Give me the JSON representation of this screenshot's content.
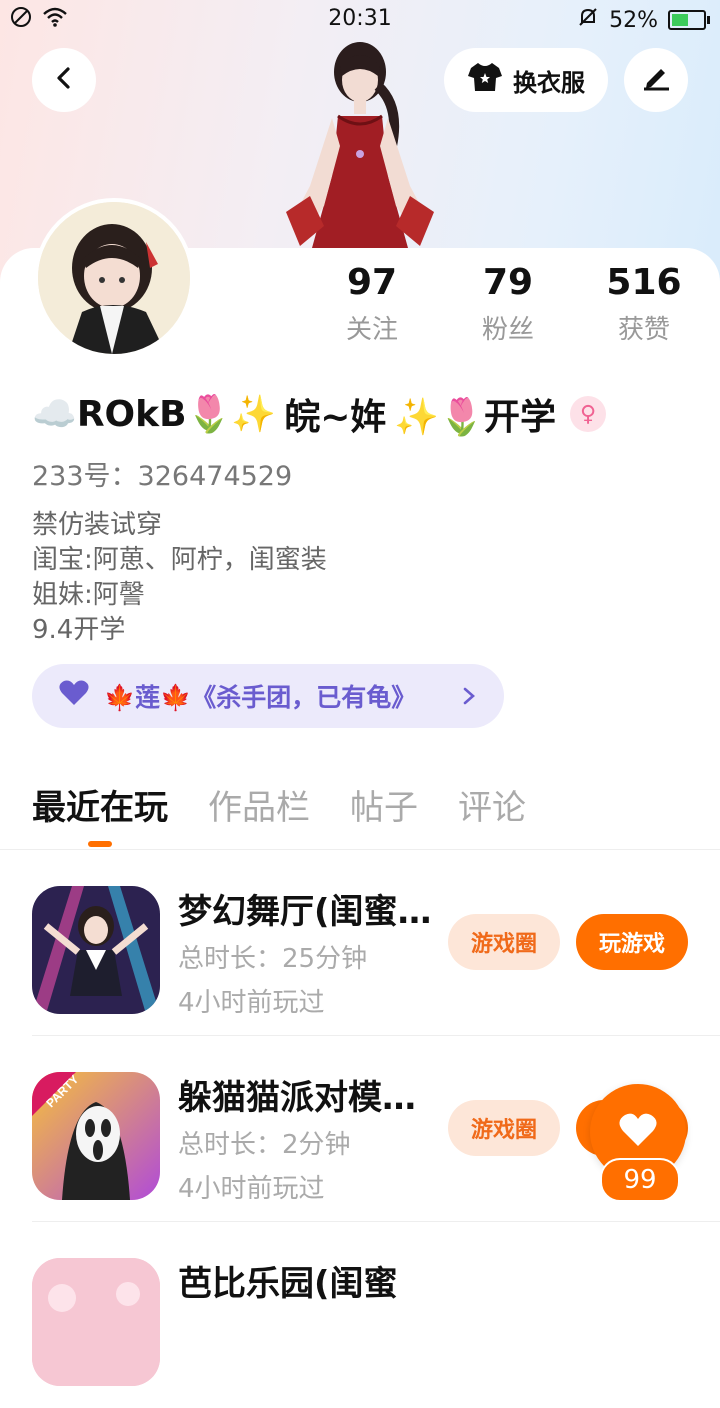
{
  "status_bar": {
    "time": "20:31",
    "battery": "52%"
  },
  "header": {
    "back_icon": "chevron-left-icon",
    "outfit_label": "换衣服",
    "edit_icon": "pen-icon"
  },
  "stats": [
    {
      "value": "97",
      "label": "关注"
    },
    {
      "value": "79",
      "label": "粉丝"
    },
    {
      "value": "516",
      "label": "获赞"
    }
  ],
  "profile": {
    "nickname_prefix": "☁️ROkB🌷✨",
    "nickname_mid": "皖~姩",
    "nickname_suffix": "✨🌷开学",
    "gender_icon": "female-symbol-icon",
    "uid_label": "233号：",
    "uid_value": "326474529",
    "bio": [
      "禁仿装试穿",
      "闺宝:阿葸、阿柠，闺蜜装",
      "姐妹:阿謦",
      "9.4开学"
    ]
  },
  "team": {
    "text": "🍁莲🍁《杀手团，已有龟》",
    "icon": "heart-icon"
  },
  "tabs": [
    {
      "label": "最近在玩",
      "active": true
    },
    {
      "label": "作品栏",
      "active": false
    },
    {
      "label": "帖子",
      "active": false
    },
    {
      "label": "评论",
      "active": false
    }
  ],
  "games": [
    {
      "name": "梦幻舞厅(闺蜜…",
      "duration": "总时长：25分钟",
      "last_played": "4小时前玩过",
      "circle_label": "游戏圈",
      "play_label": "玩游戏"
    },
    {
      "name": "躲猫猫派对模…",
      "duration": "总时长：2分钟",
      "last_played": "4小时前玩过",
      "circle_label": "游戏圈",
      "play_label": "玩游戏"
    },
    {
      "name": "芭比乐园(闺蜜",
      "duration": "",
      "last_played": "",
      "circle_label": "",
      "play_label": ""
    }
  ],
  "like_fab": {
    "count": "99"
  },
  "game_icon_badge": "PARTY",
  "colors": {
    "accent": "#ff6f00",
    "team_bg": "#eceafb",
    "team_text": "#6a5ccf"
  }
}
